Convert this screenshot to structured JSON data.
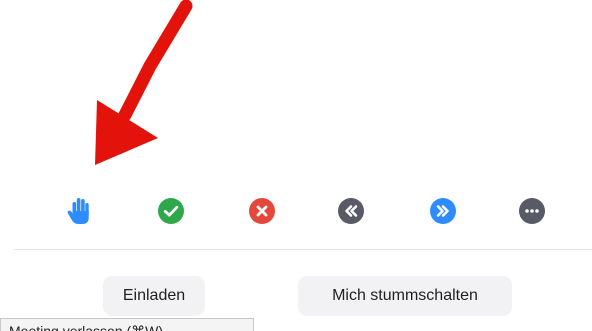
{
  "reactions": [
    {
      "icon": "raise-hand-icon",
      "color": "#2d8cff"
    },
    {
      "icon": "yes-checkmark-icon",
      "color": "#2ea84a"
    },
    {
      "icon": "no-x-icon",
      "color": "#e5473c"
    },
    {
      "icon": "go-slower-icon",
      "color": "#585b66"
    },
    {
      "icon": "go-faster-icon",
      "color": "#2d8cff"
    },
    {
      "icon": "more-icon",
      "color": "#585b66"
    }
  ],
  "buttons": {
    "invite_label": "Einladen",
    "mute_label": "Mich stummschalten"
  },
  "tooltip": {
    "text": "Meeting verlassen (⌘W)"
  },
  "annotation": {
    "color": "#e3120b"
  }
}
